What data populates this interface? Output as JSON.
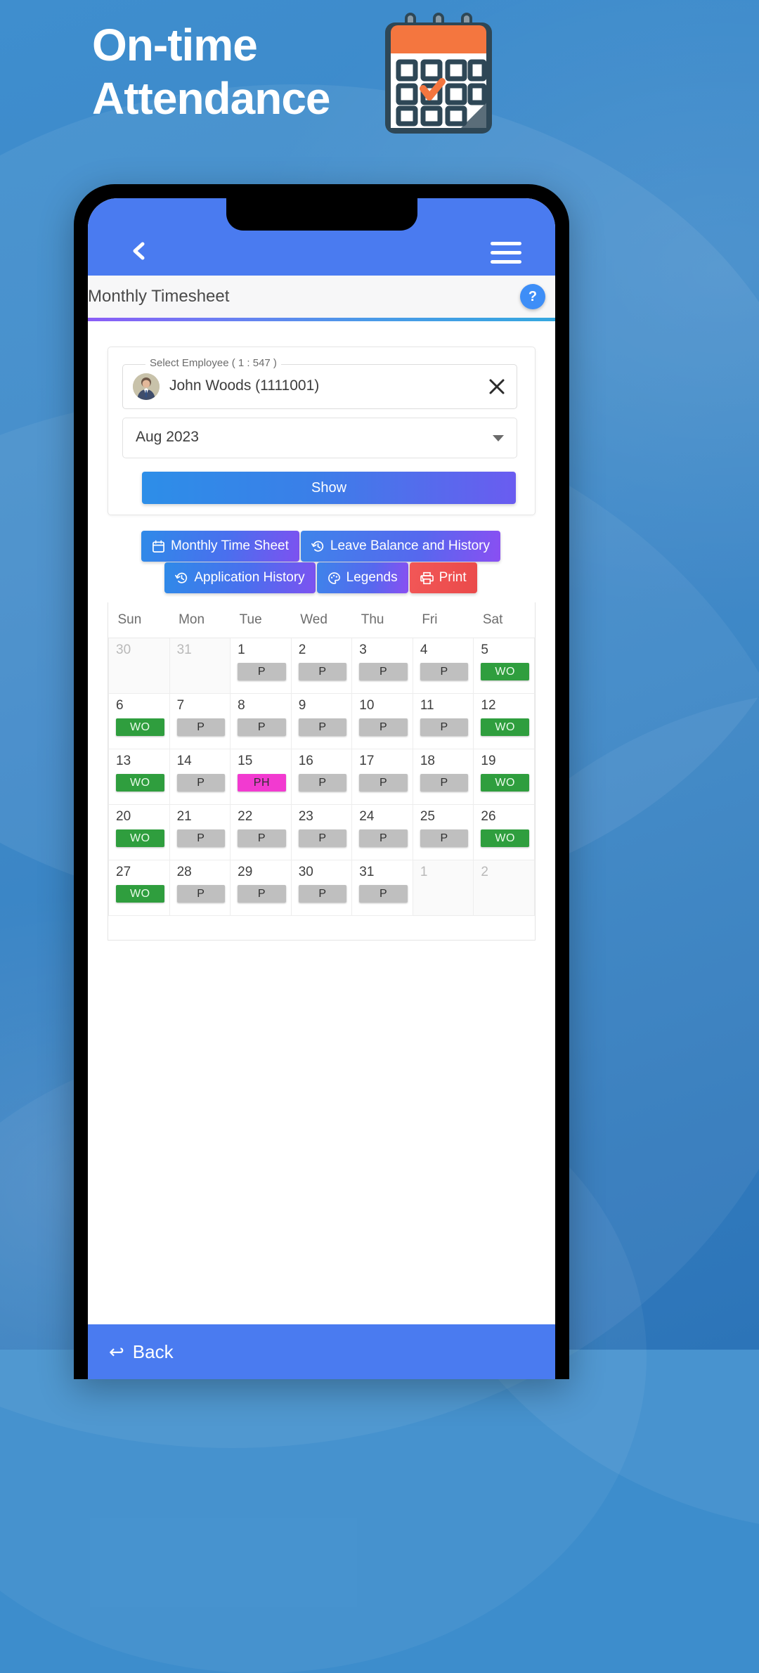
{
  "hero": {
    "line1": "On-time",
    "line2": "Attendance",
    "icon": "calendar-icon"
  },
  "appbar": {
    "back_icon": "back-chevron-icon",
    "menu_icon": "hamburger-menu-icon"
  },
  "header": {
    "title": "Monthly Timesheet",
    "help_label": "?"
  },
  "form": {
    "employee_legend": "Select Employee ( 1 : 547 )",
    "employee_value": "John  Woods (1111001)",
    "clear_icon": "close-x-icon",
    "avatar": "employee-avatar",
    "month_value": "Aug 2023",
    "month_caret": "chevron-down-icon",
    "show_label": "Show"
  },
  "tabs": [
    {
      "label": "Monthly Time Sheet",
      "icon": "calendar-icon",
      "style": "g1"
    },
    {
      "label": "Leave Balance and History",
      "icon": "history-icon",
      "style": "g2"
    },
    {
      "label": "Application History",
      "icon": "history-icon",
      "style": "g1"
    },
    {
      "label": "Legends",
      "icon": "palette-icon",
      "style": "g2"
    },
    {
      "label": "Print",
      "icon": "printer-icon",
      "style": "red"
    }
  ],
  "calendar": {
    "weekdays": [
      "Sun",
      "Mon",
      "Tue",
      "Wed",
      "Thu",
      "Fri",
      "Sat"
    ],
    "weeks": [
      [
        {
          "day": "30",
          "other": true,
          "status": ""
        },
        {
          "day": "31",
          "other": true,
          "status": ""
        },
        {
          "day": "1",
          "other": false,
          "status": "P"
        },
        {
          "day": "2",
          "other": false,
          "status": "P"
        },
        {
          "day": "3",
          "other": false,
          "status": "P"
        },
        {
          "day": "4",
          "other": false,
          "status": "P"
        },
        {
          "day": "5",
          "other": false,
          "status": "WO"
        }
      ],
      [
        {
          "day": "6",
          "other": false,
          "status": "WO"
        },
        {
          "day": "7",
          "other": false,
          "status": "P"
        },
        {
          "day": "8",
          "other": false,
          "status": "P"
        },
        {
          "day": "9",
          "other": false,
          "status": "P"
        },
        {
          "day": "10",
          "other": false,
          "status": "P"
        },
        {
          "day": "11",
          "other": false,
          "status": "P"
        },
        {
          "day": "12",
          "other": false,
          "status": "WO"
        }
      ],
      [
        {
          "day": "13",
          "other": false,
          "status": "WO"
        },
        {
          "day": "14",
          "other": false,
          "status": "P"
        },
        {
          "day": "15",
          "other": false,
          "status": "PH"
        },
        {
          "day": "16",
          "other": false,
          "status": "P"
        },
        {
          "day": "17",
          "other": false,
          "status": "P"
        },
        {
          "day": "18",
          "other": false,
          "status": "P"
        },
        {
          "day": "19",
          "other": false,
          "status": "WO"
        }
      ],
      [
        {
          "day": "20",
          "other": false,
          "status": "WO"
        },
        {
          "day": "21",
          "other": false,
          "status": "P"
        },
        {
          "day": "22",
          "other": false,
          "status": "P"
        },
        {
          "day": "23",
          "other": false,
          "status": "P"
        },
        {
          "day": "24",
          "other": false,
          "status": "P"
        },
        {
          "day": "25",
          "other": false,
          "status": "P"
        },
        {
          "day": "26",
          "other": false,
          "status": "WO"
        }
      ],
      [
        {
          "day": "27",
          "other": false,
          "status": "WO"
        },
        {
          "day": "28",
          "other": false,
          "status": "P"
        },
        {
          "day": "29",
          "other": false,
          "status": "P"
        },
        {
          "day": "30",
          "other": false,
          "status": "P"
        },
        {
          "day": "31",
          "other": false,
          "status": "P"
        },
        {
          "day": "1",
          "other": true,
          "status": ""
        },
        {
          "day": "2",
          "other": true,
          "status": ""
        }
      ]
    ],
    "status_colors": {
      "P": "#bfbfbf",
      "WO": "#2f9e3e",
      "PH": "#f23ad0"
    }
  },
  "bottom": {
    "back_label": "Back",
    "back_icon": "back-arrow-icon"
  },
  "colors": {
    "brand_blue": "#4a7bf0",
    "bg_blue": "#3d8dcc",
    "accent_orange": "#f4763f",
    "print_red": "#ef4d4d"
  }
}
